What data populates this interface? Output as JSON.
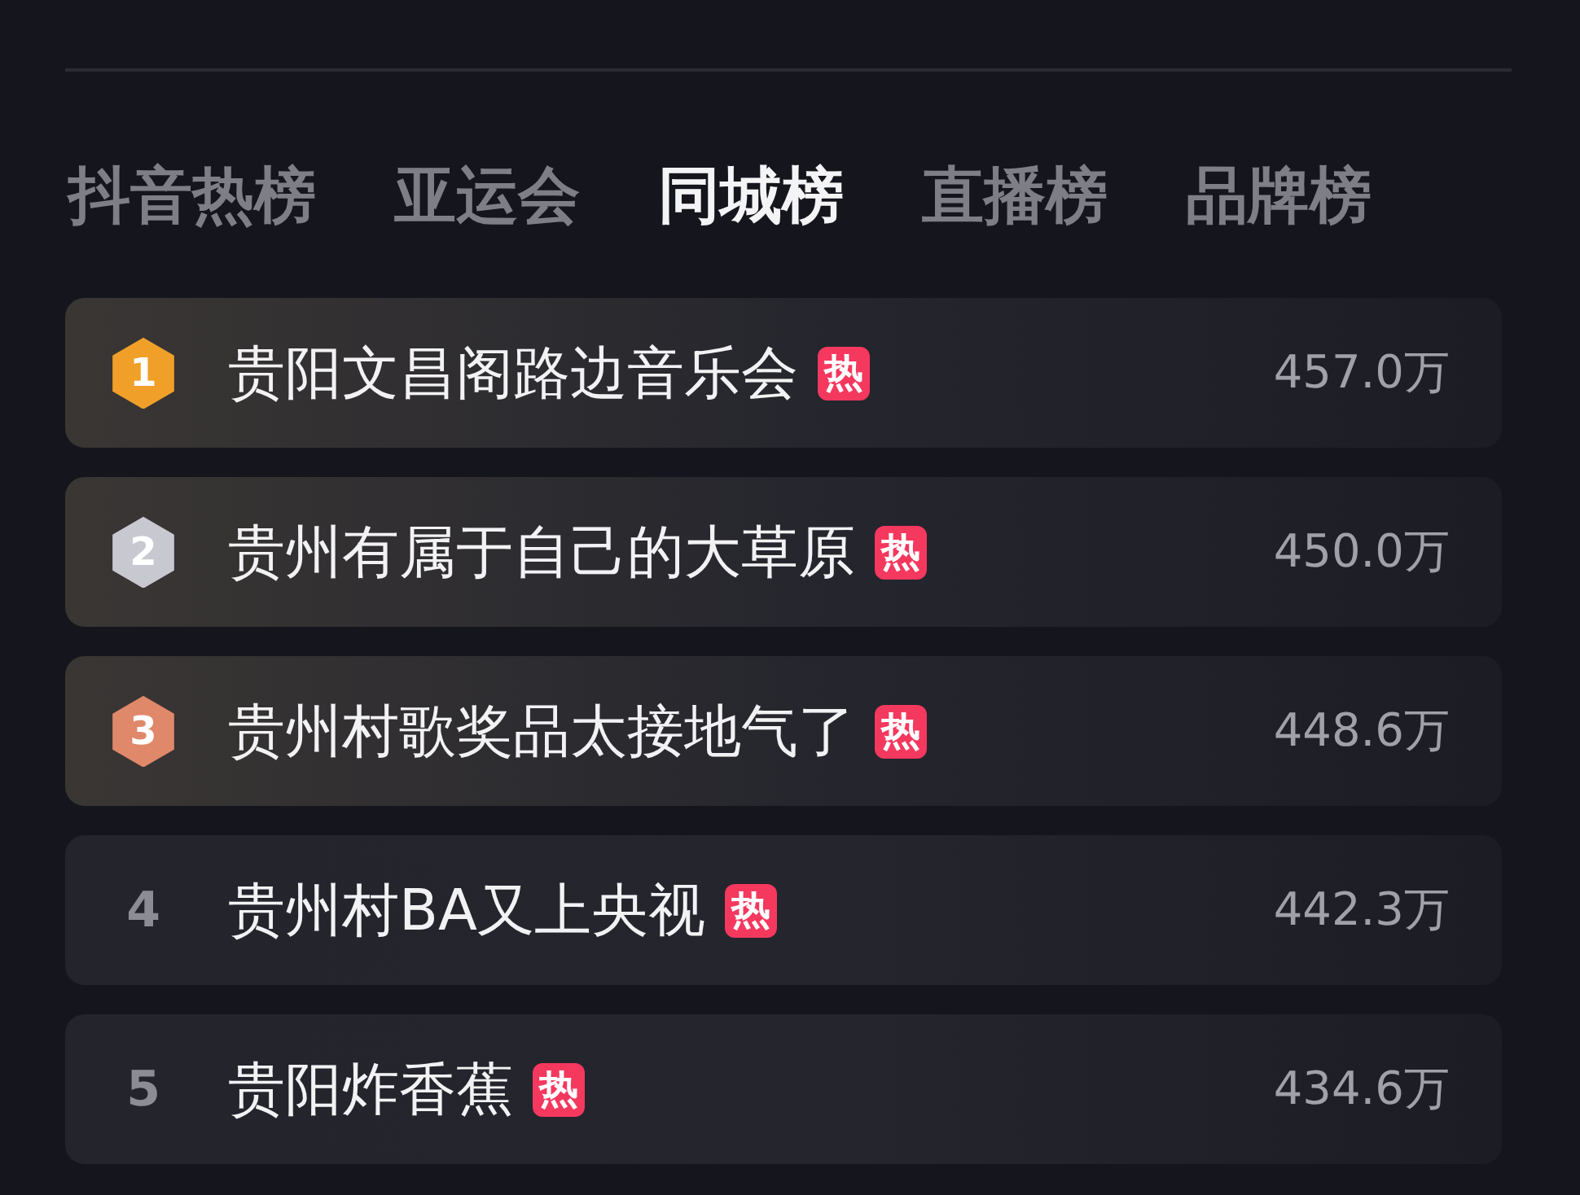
{
  "tabs": [
    {
      "label": "抖音热榜",
      "selected": false
    },
    {
      "label": "亚运会",
      "selected": false
    },
    {
      "label": "同城榜",
      "selected": true
    },
    {
      "label": "直播榜",
      "selected": false
    },
    {
      "label": "品牌榜",
      "selected": false
    }
  ],
  "rows": [
    {
      "kind": "medal",
      "rank": "1",
      "color": "#f0a028",
      "title": "贵阳文昌阁路边音乐会",
      "badge": "热",
      "value": "457.0万"
    },
    {
      "kind": "medal",
      "rank": "2",
      "color": "#c8c8d0",
      "title": "贵州有属于自己的大草原",
      "badge": "热",
      "value": "450.0万"
    },
    {
      "kind": "medal",
      "rank": "3",
      "color": "#e0886a",
      "title": "贵州村歌奖品太接地气了",
      "badge": "热",
      "value": "448.6万"
    },
    {
      "kind": "number",
      "rank": "4",
      "title": "贵州村BA又上央视",
      "badge": "热",
      "value": "442.3万"
    },
    {
      "kind": "number",
      "rank": "5",
      "title": "贵阳炸香蕉",
      "badge": "热",
      "value": "434.6万"
    }
  ]
}
